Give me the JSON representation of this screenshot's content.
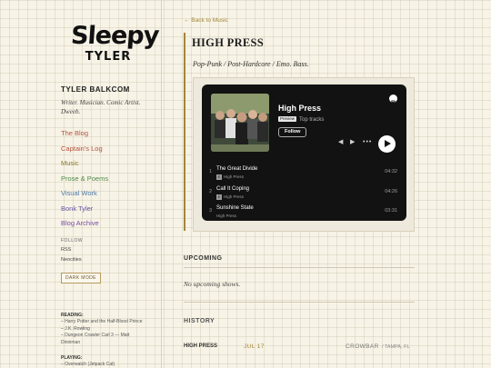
{
  "sidebar": {
    "logo_line1": "Sleepy",
    "logo_line2": "TYLER",
    "author": "TYLER BALKCOM",
    "bio": "Writer. Musician. Comic Artist. Dweeb.",
    "nav": [
      {
        "label": "The Blog",
        "color": "#b3533f"
      },
      {
        "label": "Captain's Log",
        "color": "#b3533f"
      },
      {
        "label": "Music",
        "color": "#8a7a2e"
      },
      {
        "label": "Prose & Poems",
        "color": "#4f8a4a"
      },
      {
        "label": "Visual Work",
        "color": "#4f7aa6"
      },
      {
        "label": "Bonk Tyler",
        "color": "#6a55a8"
      },
      {
        "label": "Blog Archive",
        "color": "#7a4ea0"
      }
    ],
    "follow_heading": "FOLLOW",
    "follow_links": [
      "RSS",
      "Neocities"
    ],
    "dark_mode_label": "DARK MODE",
    "reading_heading": "READING:",
    "reading_items": [
      "– Harry Potter and the Half-Blood Prince",
      "  – J.K. Rowling",
      "– Dungeon Crawler Carl 3 — Matt",
      "  Dinniman"
    ],
    "playing_heading": "PLAYING:",
    "playing_item": "– Overwatch (Jetpack Cat)"
  },
  "main": {
    "back_label": "← Back to Music",
    "title": "HIGH PRESS",
    "subtitle": "Pop-Punk / Post-Hardcore / Emo. Bass.",
    "player": {
      "title": "High Press",
      "preview_badge": "Preview",
      "subtitle": "Top tracks",
      "follow_label": "Follow",
      "tracks": [
        {
          "num": "1",
          "name": "The Great Divide",
          "artist": "High Press",
          "explicit": "E",
          "duration": "04:32"
        },
        {
          "num": "2",
          "name": "Call It Coping",
          "artist": "High Press",
          "explicit": "E",
          "duration": "04:26"
        },
        {
          "num": "3",
          "name": "Sunshine State",
          "artist": "High Press",
          "explicit": "",
          "duration": "03:31"
        }
      ]
    },
    "upcoming_heading": "UPCOMING",
    "upcoming_empty": "No upcoming shows.",
    "history_heading": "HISTORY",
    "history": [
      {
        "band": "HIGH PRESS",
        "date": "JUL 17",
        "venue": "CROWBAR",
        "city": "/ TAMPA, FL"
      }
    ]
  },
  "colors": {
    "accent": "#a4873a",
    "page_background": "#f7f3e6",
    "player_background": "#121212"
  }
}
